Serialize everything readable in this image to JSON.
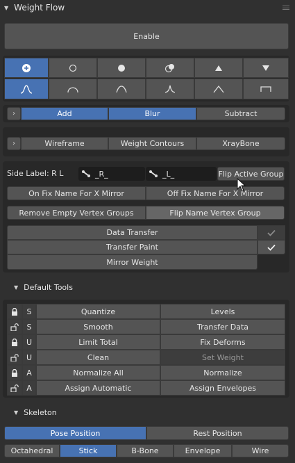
{
  "weight_flow": {
    "title": "Weight Flow",
    "enable_label": "Enable",
    "modes": [
      "Add",
      "Blur",
      "Subtract"
    ],
    "overlays": [
      "Wireframe",
      "Weight Contours",
      "XrayBone"
    ],
    "side_label": "Side Label: R L",
    "right_suffix": "_R_",
    "left_suffix": "_L_",
    "flip_active_group": "Flip Active Group",
    "on_fix_name": "On Fix Name For X Mirror",
    "off_fix_name": "Off Fix Name For X Mirror",
    "remove_empty": "Remove Empty Vertex Groups",
    "flip_name": "Flip Name Vertex Group",
    "data_transfer": "Data Transfer",
    "transfer_paint": "Transfer Paint",
    "mirror_weight": "Mirror Weight"
  },
  "default_tools": {
    "title": "Default Tools",
    "rows": [
      {
        "locked": true,
        "key": "S",
        "left": "Quantize",
        "right": "Levels"
      },
      {
        "locked": false,
        "key": "S",
        "left": "Smooth",
        "right": "Transfer Data"
      },
      {
        "locked": true,
        "key": "U",
        "left": "Limit Total",
        "right": "Fix Deforms"
      },
      {
        "locked": false,
        "key": "U",
        "left": "Clean",
        "right": "Set Weight"
      },
      {
        "locked": true,
        "key": "A",
        "left": "Normalize All",
        "right": "Normalize"
      },
      {
        "locked": false,
        "key": "A",
        "left": "Assign Automatic",
        "right": "Assign Envelopes"
      }
    ]
  },
  "skeleton": {
    "title": "Skeleton",
    "pose_position": "Pose Position",
    "rest_position": "Rest Position",
    "display_types": [
      "Octahedral",
      "Stick",
      "B-Bone",
      "Envelope",
      "Wire"
    ],
    "active_display": "Stick"
  },
  "colors": {
    "accent": "#4772b3",
    "panel": "#303030",
    "button": "#545454"
  }
}
